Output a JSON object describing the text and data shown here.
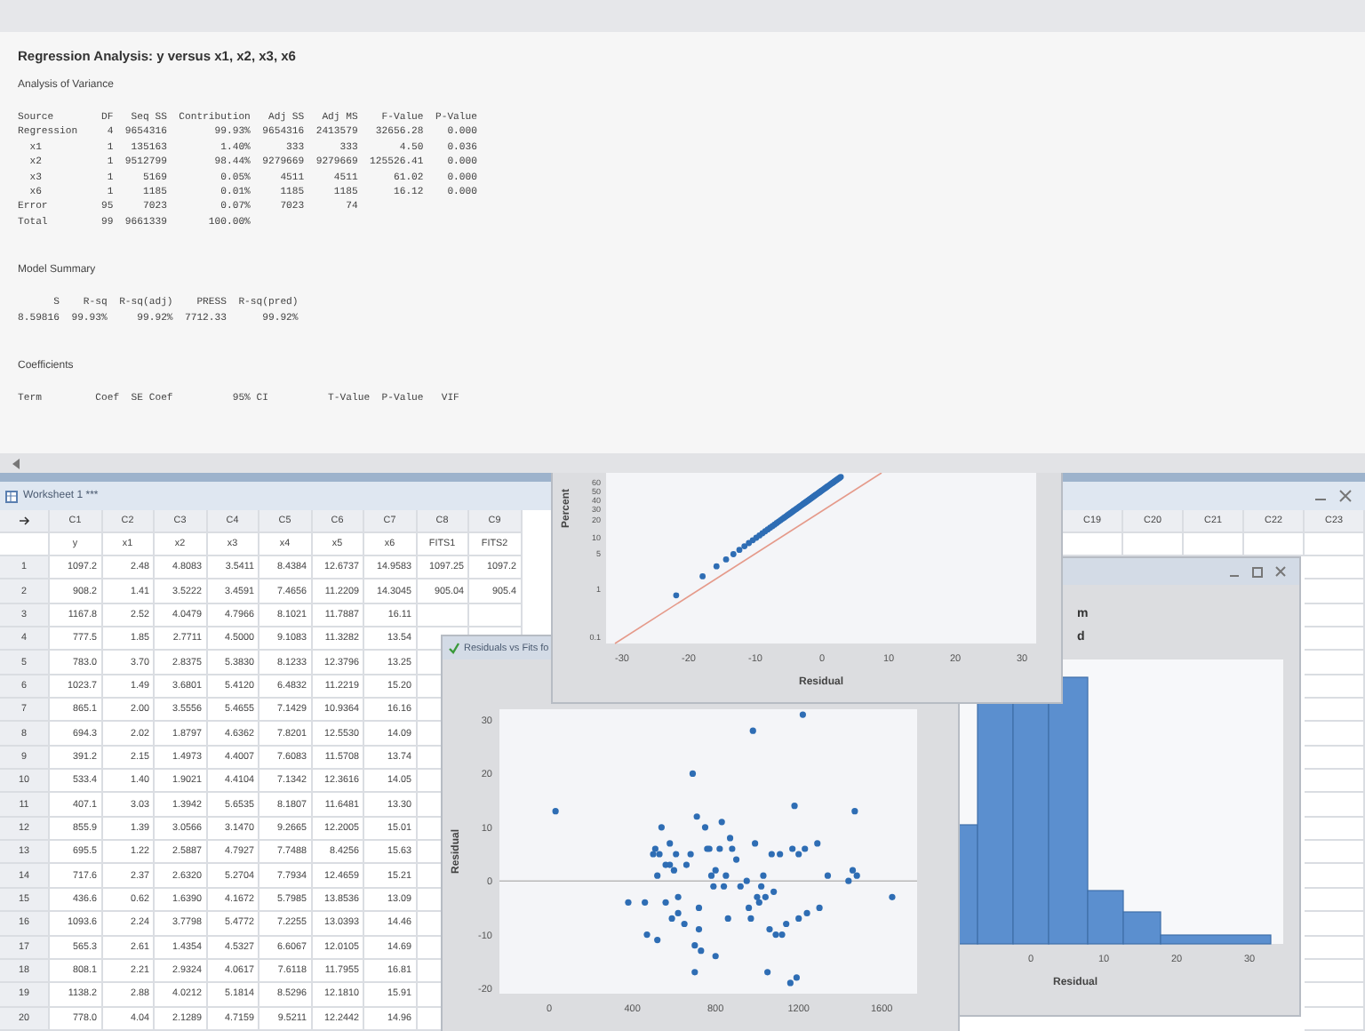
{
  "session": {
    "title": "Regression Analysis: y versus x1, x2, x3, x6",
    "sections": [
      {
        "heading": "Analysis of Variance",
        "lines": [
          "Source        DF   Seq SS  Contribution   Adj SS   Adj MS    F-Value  P-Value",
          "Regression     4  9654316        99.93%  9654316  2413579   32656.28    0.000",
          "  x1           1   135163         1.40%      333      333       4.50    0.036",
          "  x2           1  9512799        98.44%  9279669  9279669  125526.41    0.000",
          "  x3           1     5169         0.05%     4511     4511      61.02    0.000",
          "  x6           1     1185         0.01%     1185     1185      16.12    0.000",
          "Error         95     7023         0.07%     7023       74",
          "Total         99  9661339       100.00%"
        ]
      },
      {
        "heading": "Model Summary",
        "lines": [
          "      S    R-sq  R-sq(adj)    PRESS  R-sq(pred)",
          "8.59816  99.93%     99.92%  7712.33      99.92%"
        ]
      },
      {
        "heading": "Coefficients",
        "lines": [
          "Term         Coef  SE Coef          95% CI          T-Value  P-Value   VIF"
        ]
      }
    ]
  },
  "worksheet": {
    "title": "Worksheet 1 ***",
    "columns": [
      {
        "id": "C1",
        "name": "y"
      },
      {
        "id": "C2",
        "name": "x1"
      },
      {
        "id": "C3",
        "name": "x2"
      },
      {
        "id": "C4",
        "name": "x3"
      },
      {
        "id": "C5",
        "name": "x4"
      },
      {
        "id": "C6",
        "name": "x5"
      },
      {
        "id": "C7",
        "name": "x6"
      },
      {
        "id": "C8",
        "name": "FITS1"
      },
      {
        "id": "C9",
        "name": "FITS2"
      }
    ],
    "far_columns": [
      "C19",
      "C20",
      "C21",
      "C22",
      "C23"
    ],
    "rows": [
      {
        "number": "1",
        "cells": [
          "1097.2",
          "2.48",
          "4.8083",
          "3.5411",
          "8.4384",
          "12.6737",
          "14.9583",
          "1097.25",
          "1097.2"
        ]
      },
      {
        "number": "2",
        "cells": [
          "908.2",
          "1.41",
          "3.5222",
          "3.4591",
          "7.4656",
          "11.2209",
          "14.3045",
          "905.04",
          "905.4"
        ]
      },
      {
        "number": "3",
        "cells": [
          "1167.8",
          "2.52",
          "4.0479",
          "4.7966",
          "8.1021",
          "11.7887",
          "16.11"
        ]
      },
      {
        "number": "4",
        "cells": [
          "777.5",
          "1.85",
          "2.7711",
          "4.5000",
          "9.1083",
          "11.3282",
          "13.54"
        ]
      },
      {
        "number": "5",
        "cells": [
          "783.0",
          "3.70",
          "2.8375",
          "5.3830",
          "8.1233",
          "12.3796",
          "13.25"
        ]
      },
      {
        "number": "6",
        "cells": [
          "1023.7",
          "1.49",
          "3.6801",
          "5.4120",
          "6.4832",
          "11.2219",
          "15.20"
        ]
      },
      {
        "number": "7",
        "cells": [
          "865.1",
          "2.00",
          "3.5556",
          "5.4655",
          "7.1429",
          "10.9364",
          "16.16"
        ]
      },
      {
        "number": "8",
        "cells": [
          "694.3",
          "2.02",
          "1.8797",
          "4.6362",
          "7.8201",
          "12.5530",
          "14.09"
        ]
      },
      {
        "number": "9",
        "cells": [
          "391.2",
          "2.15",
          "1.4973",
          "4.4007",
          "7.6083",
          "11.5708",
          "13.74"
        ]
      },
      {
        "number": "10",
        "cells": [
          "533.4",
          "1.40",
          "1.9021",
          "4.4104",
          "7.1342",
          "12.3616",
          "14.05"
        ]
      },
      {
        "number": "11",
        "cells": [
          "407.1",
          "3.03",
          "1.3942",
          "5.6535",
          "8.1807",
          "11.6481",
          "13.30"
        ]
      },
      {
        "number": "12",
        "cells": [
          "855.9",
          "1.39",
          "3.0566",
          "3.1470",
          "9.2665",
          "12.2005",
          "15.01"
        ]
      },
      {
        "number": "13",
        "cells": [
          "695.5",
          "1.22",
          "2.5887",
          "4.7927",
          "7.7488",
          "8.4256",
          "15.63"
        ]
      },
      {
        "number": "14",
        "cells": [
          "717.6",
          "2.37",
          "2.6320",
          "5.2704",
          "7.7934",
          "12.4659",
          "15.21"
        ]
      },
      {
        "number": "15",
        "cells": [
          "436.6",
          "0.62",
          "1.6390",
          "4.1672",
          "5.7985",
          "13.8536",
          "13.09"
        ]
      },
      {
        "number": "16",
        "cells": [
          "1093.6",
          "2.24",
          "3.7798",
          "5.4772",
          "7.2255",
          "13.0393",
          "14.46"
        ]
      },
      {
        "number": "17",
        "cells": [
          "565.3",
          "2.61",
          "1.4354",
          "4.5327",
          "6.6067",
          "12.0105",
          "14.69"
        ]
      },
      {
        "number": "18",
        "cells": [
          "808.1",
          "2.21",
          "2.9324",
          "4.0617",
          "7.6118",
          "11.7955",
          "16.81"
        ]
      },
      {
        "number": "19",
        "cells": [
          "1138.2",
          "2.88",
          "4.0212",
          "5.1814",
          "8.5296",
          "12.1810",
          "15.91"
        ]
      },
      {
        "number": "20",
        "cells": [
          "778.0",
          "4.04",
          "2.1289",
          "4.7159",
          "9.5211",
          "12.2442",
          "14.96"
        ]
      }
    ]
  },
  "probability_plot": {
    "ylabel": "Percent",
    "yticks": [
      "60",
      "50",
      "40",
      "30",
      "20",
      "10",
      "5",
      "1",
      "0.1"
    ],
    "xticks": [
      "-30",
      "-20",
      "-10",
      "0",
      "10",
      "20",
      "30"
    ],
    "xlabel": "Residual"
  },
  "histogram": {
    "title_fragments": [
      "m",
      "d"
    ],
    "xticks": [
      "0",
      "10",
      "20",
      "30"
    ],
    "xlabel": "Residual"
  },
  "residuals_vs_fits": {
    "title": "Residuals vs Fits fo",
    "chart_data": {
      "type": "scatter",
      "ylabel": "Residual",
      "xlim": [
        -240,
        1770
      ],
      "ylim": [
        -21,
        32
      ],
      "xticks": [
        0,
        400,
        800,
        1200,
        1600
      ],
      "yticks": [
        -20,
        -10,
        0,
        10,
        20,
        30
      ],
      "x": [
        30,
        380,
        460,
        470,
        520,
        500,
        510,
        520,
        530,
        540,
        560,
        560,
        580,
        580,
        590,
        600,
        610,
        620,
        620,
        650,
        660,
        680,
        690,
        700,
        700,
        710,
        720,
        720,
        730,
        750,
        760,
        770,
        780,
        790,
        800,
        800,
        820,
        830,
        840,
        850,
        860,
        870,
        880,
        900,
        920,
        950,
        960,
        970,
        980,
        990,
        1000,
        1010,
        1020,
        1030,
        1040,
        1050,
        1060,
        1070,
        1080,
        1090,
        1110,
        1120,
        1140,
        1160,
        1170,
        1180,
        1190,
        1200,
        1200,
        1220,
        1230,
        1240,
        1290,
        1300,
        1340,
        1440,
        1460,
        1470,
        1480,
        1650
      ],
      "values": [
        13,
        -4,
        -4,
        -10,
        -11,
        5,
        6,
        1,
        5,
        10,
        3,
        -4,
        7,
        3,
        -7,
        2,
        5,
        -3,
        -6,
        -8,
        3,
        5,
        20,
        -12,
        -17,
        12,
        -5,
        -9,
        -13,
        10,
        6,
        6,
        1,
        -1,
        -14,
        2,
        6,
        11,
        -1,
        1,
        -7,
        8,
        6,
        4,
        -1,
        0,
        -5,
        -7,
        28,
        7,
        -3,
        -4,
        -1,
        1,
        -3,
        -17,
        -9,
        5,
        -2,
        -10,
        5,
        -10,
        -8,
        -19,
        6,
        14,
        -18,
        5,
        -7,
        31,
        6,
        -6,
        7,
        -5,
        1,
        0,
        2,
        13,
        1,
        -3
      ]
    }
  }
}
